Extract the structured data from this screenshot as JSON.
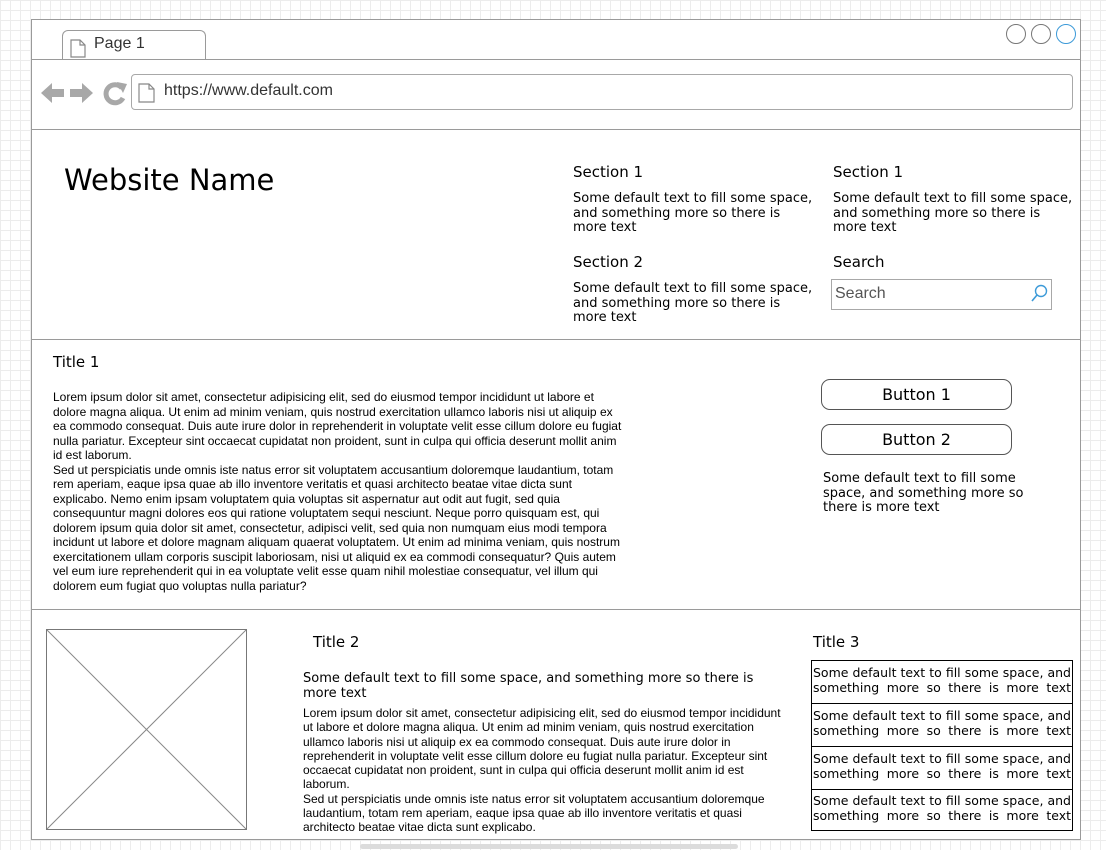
{
  "browser": {
    "tab_label": "Page 1",
    "url": "https://www.default.com"
  },
  "header": {
    "site_name": "Website Name",
    "sections": [
      {
        "title": "Section 1",
        "text": "Some default text to fill some space, and something more so there is more text"
      },
      {
        "title": "Section 1",
        "text": "Some default text to fill some space, and something more so there is more text"
      },
      {
        "title": "Section 2",
        "text": "Some default text to fill some space, and something more so there is more text"
      }
    ],
    "search": {
      "title": "Search",
      "placeholder": "Search"
    }
  },
  "main": {
    "title": "Title 1",
    "paragraphs": [
      "Lorem ipsum dolor sit amet, consectetur adipisicing elit, sed do eiusmod tempor incididunt ut labore et dolore magna aliqua. Ut enim ad minim veniam, quis nostrud exercitation ullamco laboris nisi ut aliquip ex ea commodo consequat. Duis aute irure dolor in reprehenderit in voluptate velit esse cillum dolore eu fugiat nulla pariatur. Excepteur sint occaecat cupidatat non proident, sunt in culpa qui officia deserunt mollit anim id est laborum.",
      "Sed ut perspiciatis unde omnis iste natus error sit voluptatem accusantium doloremque laudantium, totam rem aperiam, eaque ipsa quae ab illo inventore veritatis et quasi architecto beatae vitae dicta sunt explicabo. Nemo enim ipsam voluptatem quia voluptas sit aspernatur aut odit aut fugit, sed quia consequuntur magni dolores eos qui ratione voluptatem sequi nesciunt. Neque porro quisquam est, qui dolorem ipsum quia dolor sit amet, consectetur, adipisci velit, sed quia non numquam eius modi tempora incidunt ut labore et dolore magnam aliquam quaerat voluptatem. Ut enim ad minima veniam, quis nostrum exercitationem ullam corporis suscipit laboriosam, nisi ut aliquid ex ea commodi consequatur? Quis autem vel eum iure reprehenderit qui in ea voluptate velit esse quam nihil molestiae consequatur, vel illum qui dolorem eum fugiat quo voluptas nulla pariatur?"
    ],
    "buttons": [
      "Button 1",
      "Button 2"
    ],
    "side_text": "Some default text to fill some space, and something more so there is more text"
  },
  "bottom": {
    "title2": "Title 2",
    "intro": "Some default text to fill some space, and something more so there is more text",
    "paragraphs": [
      "Lorem ipsum dolor sit amet, consectetur adipisicing elit, sed do eiusmod tempor incididunt ut labore et dolore magna aliqua. Ut enim ad minim veniam, quis nostrud exercitation ullamco laboris nisi ut aliquip ex ea commodo consequat. Duis aute irure dolor in reprehenderit in voluptate velit esse cillum dolore eu fugiat nulla pariatur. Excepteur sint occaecat cupidatat non proident, sunt in culpa qui officia deserunt mollit anim id est laborum.",
      "Sed ut perspiciatis unde omnis iste natus error sit voluptatem accusantium doloremque laudantium, totam rem aperiam, eaque ipsa quae ab illo inventore veritatis et quasi architecto beatae vitae dicta sunt explicabo."
    ],
    "title3": "Title 3",
    "list": [
      "Some default text to fill some space, and something more so there is more text",
      "Some default text to fill some space, and something more so there is more text",
      "Some default text to fill some space, and something more so there is more text",
      "Some default text to fill some space, and something more so there is more text"
    ]
  }
}
